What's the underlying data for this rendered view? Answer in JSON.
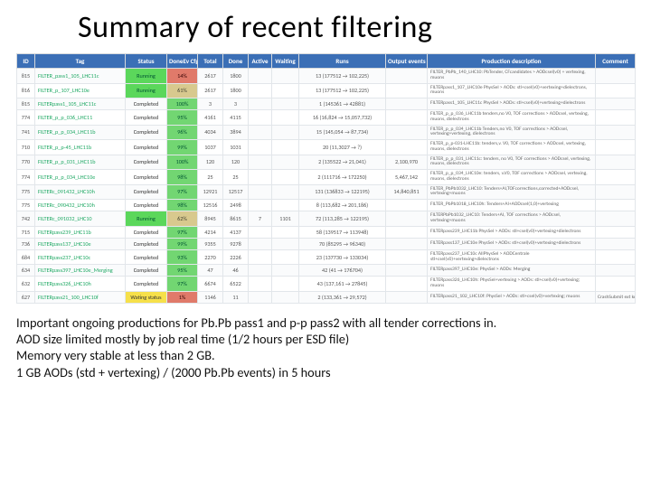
{
  "title": "Summary of recent filtering",
  "headers": [
    "ID",
    "Tag",
    "Status",
    "DoneEv Cfg Out",
    "Total",
    "Done",
    "Active",
    "Waiting",
    "Runs",
    "Output events",
    "Production description",
    "Comment"
  ],
  "rows": [
    {
      "id": "815",
      "tag": "FILTER_pass1_105_LHC11c",
      "st": "Running",
      "stc": "st-run",
      "pct": "14%",
      "pctc": "pct-red",
      "c": [
        "2617",
        "1800",
        "",
        "",
        "13 (177512 → 102,225)",
        "",
        "FILTER_PbPb_140_LHC10: PbTender, CFcandidates > AODcsel(v0) + vertexing, muons"
      ]
    },
    {
      "id": "816",
      "tag": "FILTER_p_107_LHC10e",
      "st": "Running",
      "stc": "st-run",
      "pct": "61%",
      "pctc": "pct-tan",
      "c": [
        "2617",
        "1800",
        "",
        "",
        "13 (177512 → 102,225)",
        "",
        "FILTERpass1_107_LHC10e PhysSel > AODs: stl+csel(v0)+vertexing+dielectrons, muons"
      ]
    },
    {
      "id": "815",
      "tag": "FILTERpass1_105_LHC11c",
      "st": "Completed",
      "stc": "st-done",
      "pct": "100%",
      "pctc": "pct-green",
      "c": [
        "3",
        "3",
        "",
        "",
        "1 (145361 → 42881)",
        "",
        "FILTERpass1_105_LHC11c PhysSel > AODs: stl+csel(v0)+vertexing+dielectrons"
      ]
    },
    {
      "id": "774",
      "tag": "FILTER_p_p_036_LHC11",
      "st": "Completed",
      "stc": "st-done",
      "pct": "95%",
      "pctc": "pct-green",
      "c": [
        "4161",
        "4115",
        "",
        "",
        "16 (16,824 → 15,057,732)",
        "",
        "FILTER_p_p_036_LHC11b tenders,no V0, TOF corrections > AODcsel, vertexing, muons, dielectrons"
      ]
    },
    {
      "id": "741",
      "tag": "FILTER_p_p_034_LHC11b",
      "st": "Completed",
      "stc": "st-done",
      "pct": "96%",
      "pctc": "pct-green",
      "c": [
        "4034",
        "3894",
        "",
        "",
        "15 (145,054 → 87,734)",
        "",
        "FILTER_p_p_034_LHC11b Tenders,no V0, TOF corrections > AODcsel, vertexing+vertexing, dielectrons"
      ]
    },
    {
      "id": "710",
      "tag": "FILTER_p_p-45_LHC11b",
      "st": "Completed",
      "stc": "st-done",
      "pct": "99%",
      "pctc": "pct-green",
      "c": [
        "1037",
        "1031",
        "",
        "",
        "20 (11,3027 → ?)",
        "",
        "FILTER_p_p-031-LHC11b: tenders,v. V0, TOF corrections > AODcsel, vertexing, muons, dielectrons"
      ]
    },
    {
      "id": "770",
      "tag": "FILTER_p_p_031_LHC11b",
      "st": "Completed",
      "stc": "st-done",
      "pct": "100%",
      "pctc": "pct-green",
      "c": [
        "120",
        "120",
        "",
        "",
        "2 (135522 → 21,041)",
        "2,100,970",
        "FILTER_p_p_031_LHC11c: tenders, no V0, TOF corrections > AODcsel, vertexing, muons, dielectrons"
      ]
    },
    {
      "id": "774",
      "tag": "FILTER_p_p_034_LHC10e",
      "st": "Completed",
      "stc": "st-done",
      "pct": "98%",
      "pctc": "pct-green",
      "c": [
        "25",
        "25",
        "",
        "",
        "2 (111716 → 172250)",
        "5,467,142",
        "FILTER_p_p_034_LHC10e: tenders, v.V0, TOF corrections > AODcsel, vertexing, muons, dielectrons"
      ]
    },
    {
      "id": "775",
      "tag": "FILTERc_091432_LHC10h",
      "st": "Completed",
      "stc": "st-done",
      "pct": "97%",
      "pctc": "pct-green",
      "c": [
        "12921",
        "12517",
        "",
        "",
        "131 (136833 → 122195)",
        "14,840,851",
        "FILTER_PbPb1032_LHC10: Tenders+AI,TOFcorrections,corrected+AODcsel, vertexing+muons"
      ]
    },
    {
      "id": "775",
      "tag": "FILTERc_090432_LHC10h",
      "st": "Completed",
      "stc": "st-done",
      "pct": "98%",
      "pctc": "pct-green",
      "c": [
        "12516",
        "2498",
        "",
        "",
        "8 (113,682 → 201,186)",
        "",
        "FILTER_PbPb1018_LHC10h: Tenders+AI+AODcsel(1,0)+vertexing"
      ]
    },
    {
      "id": "742",
      "tag": "FILTERc_091032_LHC10",
      "st": "Running",
      "stc": "st-run",
      "pct": "62%",
      "pctc": "pct-tan",
      "c": [
        "8945",
        "8615",
        "7",
        "1101",
        "72 (113,285 → 122195)",
        "",
        "FILTERPbPb1032_LHC10: Tenders+AI, TOF corrections > AODcsel, vertexing+muons"
      ]
    },
    {
      "id": "715",
      "tag": "FILTERpass239_LHC11b",
      "st": "Completed",
      "stc": "st-done",
      "pct": "97%",
      "pctc": "pct-green",
      "c": [
        "4214",
        "4137",
        "",
        "",
        "58 (139517 → 113948)",
        "",
        "FILTERpass239_LHC11b PhysSel > AODs: stl+csel(v0)+vertexing+dielectrons"
      ]
    },
    {
      "id": "736",
      "tag": "FILTERpass137_LHC10e",
      "st": "Completed",
      "stc": "st-done",
      "pct": "99%",
      "pctc": "pct-green",
      "c": [
        "9355",
        "9278",
        "",
        "",
        "70 (85295 → 96340)",
        "",
        "FILTERpass137_LHC10e PhysSel > AODs: stl+csel(v0)+vertexing+dielectrons"
      ]
    },
    {
      "id": "684",
      "tag": "FILTERpass237_LHC10c",
      "st": "Completed",
      "stc": "st-done",
      "pct": "93%",
      "pctc": "pct-green",
      "c": [
        "2270",
        "2226",
        "",
        "",
        "23 (137730 → 133034)",
        "",
        "FILTERpass237_LHC10c AllPhysSel > AODCentrale stl+csel(v0)+vertexing+dielectrons"
      ]
    },
    {
      "id": "634",
      "tag": "FILTERpass397_LHC10e_Merging",
      "st": "Completed",
      "stc": "st-done",
      "pct": "95%",
      "pctc": "pct-green",
      "c": [
        "47",
        "46",
        "",
        "",
        "42 (41 → 176704)",
        "",
        "FILTERpass397_LHC10e: PhysSel > AODs: Merging"
      ]
    },
    {
      "id": "632",
      "tag": "FILTERpass326_LHC10h",
      "st": "Completed",
      "stc": "st-done",
      "pct": "97%",
      "pctc": "pct-green",
      "c": [
        "6674",
        "6522",
        "",
        "",
        "43 (137,161 → 27845)",
        "",
        "FILTERpass326_LHC10h: PhysSel+vertexing > AODs: stl+csel(v0)+vertexing; muons"
      ]
    },
    {
      "id": "627",
      "tag": "FILTERpass21_100_LHC10f",
      "st": "Wating status",
      "stc": "st-last",
      "pct": "1%",
      "pctc": "pct-red",
      "c": [
        "1146",
        "11",
        "",
        "",
        "2 (133,361 → 29,572)",
        "",
        "FILTERpass21_102_LHC10f: PhysSel > AODs: stl+csel(v0)+vertexing; muons",
        "CrashSubmit ext known"
      ]
    }
  ],
  "notes": [
    "Important ongoing productions for Pb.Pb pass1 and p-p pass2 with all tender corrections in.",
    "AOD size limited mostly by job real time (1/2 hours per ESD file)",
    "Memory very stable at less than 2 GB.",
    "1 GB AODs (std + vertexing) / (2000 Pb.Pb events) in 5 hours"
  ]
}
